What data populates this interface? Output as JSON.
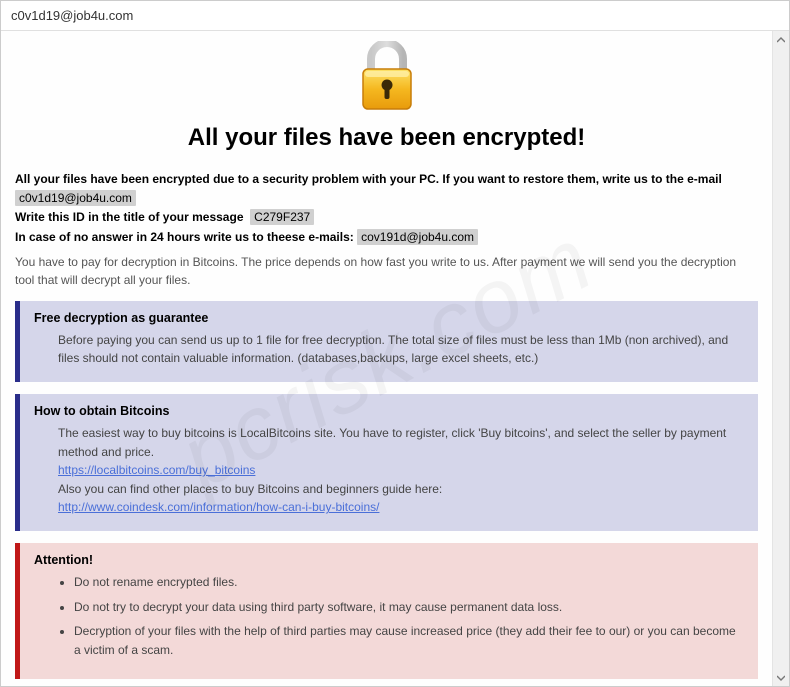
{
  "window": {
    "title": "c0v1d19@job4u.com"
  },
  "heading": "All your files have been encrypted!",
  "intro": {
    "line1_prefix": "All your files have been encrypted due to a security problem with your PC. If you want to restore them, write us to the e-mail",
    "email1": "c0v1d19@job4u.com",
    "line2_prefix": "Write this ID in the title of your message",
    "id_code": "C279F237",
    "line3_prefix": "In case of no answer in 24 hours write us to theese e-mails:",
    "email2": "cov191d@job4u.com"
  },
  "paytext": "You have to pay for decryption in Bitcoins. The price depends on how fast you write to us. After payment we will send you the decryption tool that will decrypt all your files.",
  "panel_guarantee": {
    "title": "Free decryption as guarantee",
    "body": "Before paying you can send us up to 1 file for free decryption. The total size of files must be less than 1Mb (non archived), and files should not contain valuable information. (databases,backups, large excel sheets, etc.)"
  },
  "panel_obtain": {
    "title": "How to obtain Bitcoins",
    "line1": "The easiest way to buy bitcoins is LocalBitcoins site. You have to register, click 'Buy bitcoins', and select the seller by payment method and price.",
    "link1": "https://localbitcoins.com/buy_bitcoins",
    "line2": "Also you can find other places to buy Bitcoins and beginners guide here:",
    "link2": "http://www.coindesk.com/information/how-can-i-buy-bitcoins/"
  },
  "panel_attention": {
    "title": "Attention!",
    "items": [
      "Do not rename encrypted files.",
      "Do not try to decrypt your data using third party software, it may cause permanent data loss.",
      "Decryption of your files with the help of third parties may cause increased price (they add their fee to our) or you can become a victim of a scam."
    ]
  },
  "watermark": "pcrisk.com"
}
